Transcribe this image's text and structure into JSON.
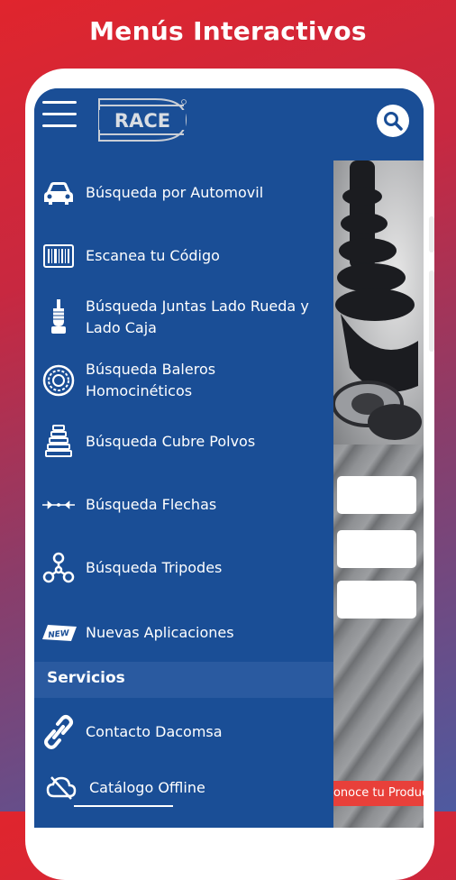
{
  "headline": "Menús Interactivos",
  "app": {
    "logo_text": "RACE",
    "menu_items": [
      {
        "label": "Búsqueda por Automovil",
        "icon": "car-icon"
      },
      {
        "label": "Escanea tu Código",
        "icon": "barcode-icon"
      },
      {
        "label": "Búsqueda Juntas Lado Rueda y Lado Caja",
        "icon": "cv-joint-icon"
      },
      {
        "label": "Búsqueda Baleros Homocinéticos",
        "icon": "bearing-icon"
      },
      {
        "label": "Búsqueda Cubre Polvos",
        "icon": "dust-boot-icon"
      },
      {
        "label": "Búsqueda Flechas",
        "icon": "shaft-icon"
      },
      {
        "label": "Búsqueda Tripodes",
        "icon": "tripod-icon"
      },
      {
        "label": "Nuevas Aplicaciones",
        "icon": "new-badge-icon"
      }
    ],
    "section_header": "Servicios",
    "service_items": [
      {
        "label": "Contacto Dacomsa",
        "icon": "link-icon"
      },
      {
        "label": "Catálogo Offline",
        "icon": "cloud-offline-icon"
      }
    ],
    "background_cta": "¿Conoce tu Producto?"
  },
  "colors": {
    "drawer": "#1a4e96",
    "section": "#2a5aa0",
    "cta": "#e8403a"
  }
}
